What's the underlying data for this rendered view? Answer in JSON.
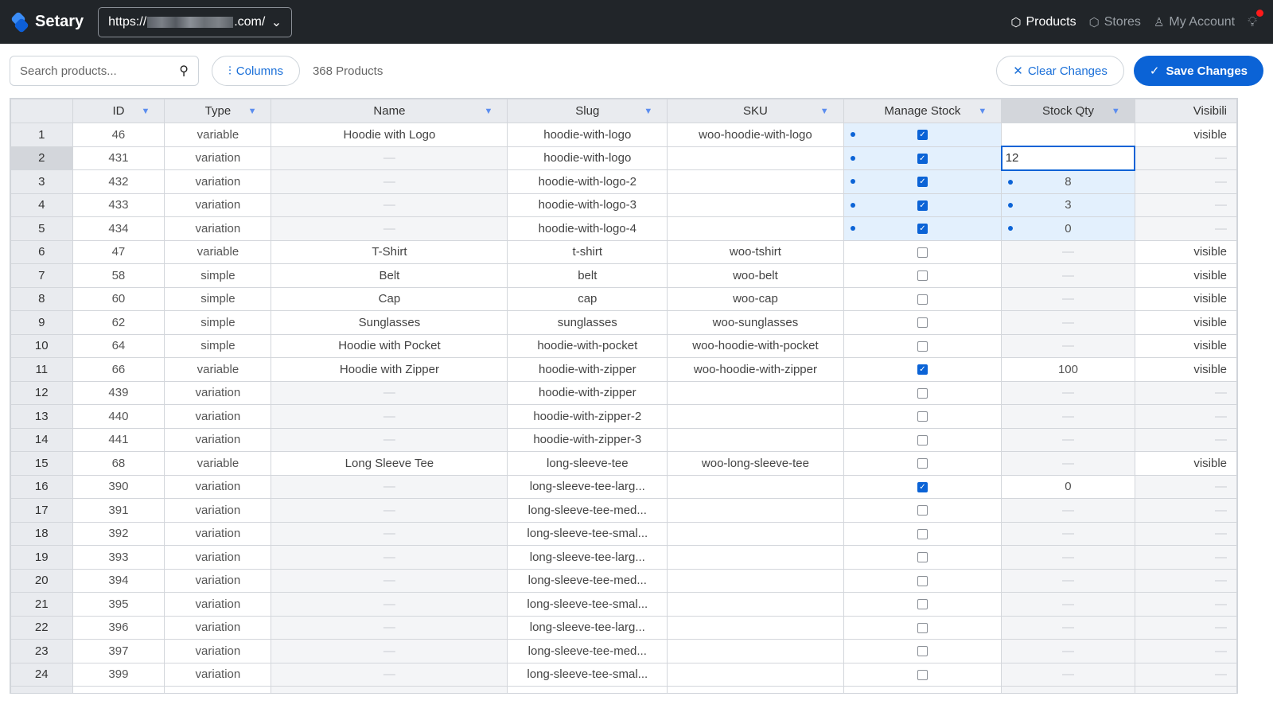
{
  "app": {
    "name": "Setary",
    "store_url_prefix": "https://",
    "store_url_suffix": ".com/"
  },
  "nav": [
    {
      "label": "Products",
      "icon": "box-icon",
      "active": true
    },
    {
      "label": "Stores",
      "icon": "boxes-icon",
      "active": false
    },
    {
      "label": "My Account",
      "icon": "user-icon",
      "active": false
    }
  ],
  "toolbar": {
    "search_placeholder": "Search products...",
    "columns_label": "Columns",
    "count_label": "368 Products",
    "clear_label": "Clear Changes",
    "save_label": "Save Changes"
  },
  "columns": [
    "ID",
    "Type",
    "Name",
    "Slug",
    "SKU",
    "Manage Stock",
    "Stock Qty",
    "Visibili"
  ],
  "rows": [
    {
      "n": "1",
      "id": "46",
      "type": "variable",
      "name": "Hoodie with Logo",
      "slug": "hoodie-with-logo",
      "sku": "woo-hoodie-with-logo",
      "manage": true,
      "manage_changed": true,
      "qty": "",
      "qty_state": "blank",
      "vis": "visible"
    },
    {
      "n": "2",
      "id": "431",
      "type": "variation",
      "name": "—",
      "slug": "hoodie-with-logo",
      "sku": "",
      "manage": true,
      "manage_changed": true,
      "qty": "12",
      "qty_state": "editing",
      "vis": "—"
    },
    {
      "n": "3",
      "id": "432",
      "type": "variation",
      "name": "—",
      "slug": "hoodie-with-logo-2",
      "sku": "",
      "manage": true,
      "manage_changed": true,
      "qty": "8",
      "qty_state": "changed",
      "vis": "—"
    },
    {
      "n": "4",
      "id": "433",
      "type": "variation",
      "name": "—",
      "slug": "hoodie-with-logo-3",
      "sku": "",
      "manage": true,
      "manage_changed": true,
      "qty": "3",
      "qty_state": "changed",
      "vis": "—"
    },
    {
      "n": "5",
      "id": "434",
      "type": "variation",
      "name": "—",
      "slug": "hoodie-with-logo-4",
      "sku": "",
      "manage": true,
      "manage_changed": true,
      "qty": "0",
      "qty_state": "changed",
      "vis": "—"
    },
    {
      "n": "6",
      "id": "47",
      "type": "variable",
      "name": "T-Shirt",
      "slug": "t-shirt",
      "sku": "woo-tshirt",
      "manage": false,
      "qty": "—",
      "qty_state": "empty",
      "vis": "visible"
    },
    {
      "n": "7",
      "id": "58",
      "type": "simple",
      "name": "Belt",
      "slug": "belt",
      "sku": "woo-belt",
      "manage": false,
      "qty": "—",
      "qty_state": "empty",
      "vis": "visible"
    },
    {
      "n": "8",
      "id": "60",
      "type": "simple",
      "name": "Cap",
      "slug": "cap",
      "sku": "woo-cap",
      "manage": false,
      "qty": "—",
      "qty_state": "empty",
      "vis": "visible"
    },
    {
      "n": "9",
      "id": "62",
      "type": "simple",
      "name": "Sunglasses",
      "slug": "sunglasses",
      "sku": "woo-sunglasses",
      "manage": false,
      "qty": "—",
      "qty_state": "empty",
      "vis": "visible"
    },
    {
      "n": "10",
      "id": "64",
      "type": "simple",
      "name": "Hoodie with Pocket",
      "slug": "hoodie-with-pocket",
      "sku": "woo-hoodie-with-pocket",
      "manage": false,
      "qty": "—",
      "qty_state": "empty",
      "vis": "visible"
    },
    {
      "n": "11",
      "id": "66",
      "type": "variable",
      "name": "Hoodie with Zipper",
      "slug": "hoodie-with-zipper",
      "sku": "woo-hoodie-with-zipper",
      "manage": true,
      "qty": "100",
      "qty_state": "value",
      "vis": "visible"
    },
    {
      "n": "12",
      "id": "439",
      "type": "variation",
      "name": "—",
      "slug": "hoodie-with-zipper",
      "sku": "",
      "manage": false,
      "qty": "—",
      "qty_state": "empty",
      "vis": "—"
    },
    {
      "n": "13",
      "id": "440",
      "type": "variation",
      "name": "—",
      "slug": "hoodie-with-zipper-2",
      "sku": "",
      "manage": false,
      "qty": "—",
      "qty_state": "empty",
      "vis": "—"
    },
    {
      "n": "14",
      "id": "441",
      "type": "variation",
      "name": "—",
      "slug": "hoodie-with-zipper-3",
      "sku": "",
      "manage": false,
      "qty": "—",
      "qty_state": "empty",
      "vis": "—"
    },
    {
      "n": "15",
      "id": "68",
      "type": "variable",
      "name": "Long Sleeve Tee",
      "slug": "long-sleeve-tee",
      "sku": "woo-long-sleeve-tee",
      "manage": false,
      "qty": "—",
      "qty_state": "empty",
      "vis": "visible"
    },
    {
      "n": "16",
      "id": "390",
      "type": "variation",
      "name": "—",
      "slug": "long-sleeve-tee-larg...",
      "sku": "",
      "manage": true,
      "qty": "0",
      "qty_state": "value",
      "vis": "—"
    },
    {
      "n": "17",
      "id": "391",
      "type": "variation",
      "name": "—",
      "slug": "long-sleeve-tee-med...",
      "sku": "",
      "manage": false,
      "qty": "—",
      "qty_state": "empty",
      "vis": "—"
    },
    {
      "n": "18",
      "id": "392",
      "type": "variation",
      "name": "—",
      "slug": "long-sleeve-tee-smal...",
      "sku": "",
      "manage": false,
      "qty": "—",
      "qty_state": "empty",
      "vis": "—"
    },
    {
      "n": "19",
      "id": "393",
      "type": "variation",
      "name": "—",
      "slug": "long-sleeve-tee-larg...",
      "sku": "",
      "manage": false,
      "qty": "—",
      "qty_state": "empty",
      "vis": "—"
    },
    {
      "n": "20",
      "id": "394",
      "type": "variation",
      "name": "—",
      "slug": "long-sleeve-tee-med...",
      "sku": "",
      "manage": false,
      "qty": "—",
      "qty_state": "empty",
      "vis": "—"
    },
    {
      "n": "21",
      "id": "395",
      "type": "variation",
      "name": "—",
      "slug": "long-sleeve-tee-smal...",
      "sku": "",
      "manage": false,
      "qty": "—",
      "qty_state": "empty",
      "vis": "—"
    },
    {
      "n": "22",
      "id": "396",
      "type": "variation",
      "name": "—",
      "slug": "long-sleeve-tee-larg...",
      "sku": "",
      "manage": false,
      "qty": "—",
      "qty_state": "empty",
      "vis": "—"
    },
    {
      "n": "23",
      "id": "397",
      "type": "variation",
      "name": "—",
      "slug": "long-sleeve-tee-med...",
      "sku": "",
      "manage": false,
      "qty": "—",
      "qty_state": "empty",
      "vis": "—"
    },
    {
      "n": "24",
      "id": "399",
      "type": "variation",
      "name": "—",
      "slug": "long-sleeve-tee-smal...",
      "sku": "",
      "manage": false,
      "qty": "—",
      "qty_state": "empty",
      "vis": "—"
    }
  ],
  "colors": {
    "accent": "#0b63d6",
    "topbar": "#212529",
    "changed_bg": "#e3f0fd",
    "notification": "#ff1a1a"
  }
}
